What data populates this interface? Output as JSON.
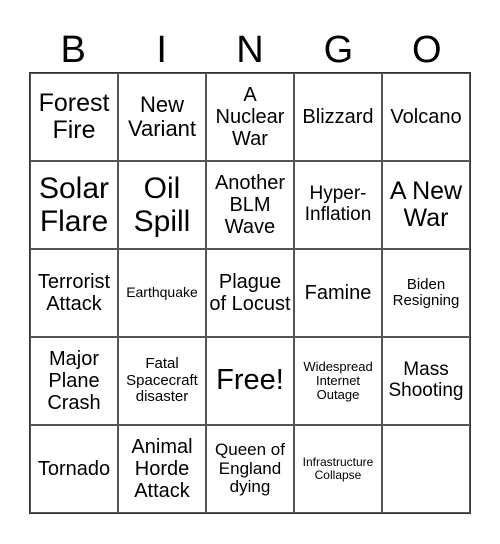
{
  "header": [
    "B",
    "I",
    "N",
    "G",
    "O"
  ],
  "cells": [
    [
      "Forest Fire",
      "New Variant",
      "A Nuclear War",
      "Blizzard",
      "Volcano"
    ],
    [
      "Solar Flare",
      "Oil Spill",
      "Another BLM Wave",
      "Hyper-Inflation",
      "A New War"
    ],
    [
      "Terrorist Attack",
      "Earthquake",
      "Plague of Locust",
      "Famine",
      "Biden Resigning"
    ],
    [
      "Major Plane Crash",
      "Fatal Spacecraft disaster",
      "Free!",
      "Widespread Internet Outage",
      "Mass Shooting"
    ],
    [
      "Tornado",
      "Animal Horde Attack",
      "Queen of England dying",
      "Infrastructure Collapse",
      ""
    ]
  ]
}
